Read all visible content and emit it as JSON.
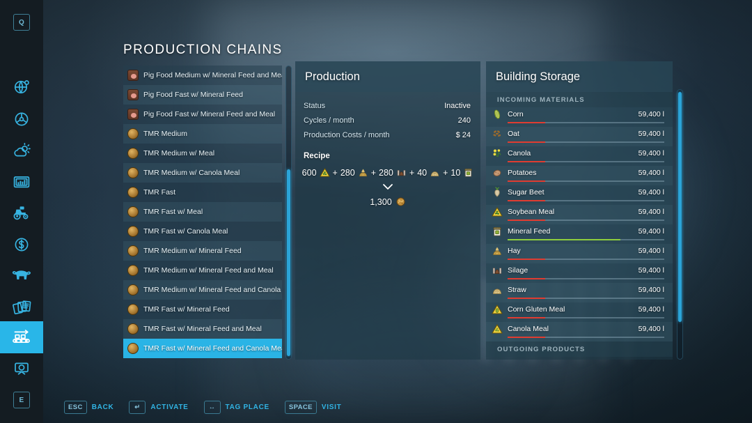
{
  "page": {
    "title": "PRODUCTION CHAINS"
  },
  "sidebar": {
    "top_key": "Q",
    "bottom_key": "E",
    "items": [
      {
        "name": "map-overview",
        "icon": "globe-icon",
        "active": false
      },
      {
        "name": "vehicles-steering",
        "icon": "steering-wheel-icon",
        "active": false
      },
      {
        "name": "weather",
        "icon": "weather-icon",
        "active": false
      },
      {
        "name": "statistics",
        "icon": "statistics-icon",
        "active": false
      },
      {
        "name": "vehicle-list",
        "icon": "tractor-icon",
        "active": false
      },
      {
        "name": "finances",
        "icon": "dollar-circle-icon",
        "active": false
      },
      {
        "name": "animals",
        "icon": "cow-icon",
        "active": false
      },
      {
        "name": "contracts",
        "icon": "documents-icon",
        "active": false
      },
      {
        "name": "production",
        "icon": "conveyor-icon",
        "active": true
      },
      {
        "name": "radio",
        "icon": "radio-icon",
        "active": false
      }
    ]
  },
  "chain_list": [
    {
      "label": "Pig Food Medium w/ Mineral Feed and Meal",
      "icon": "pig-food-icon",
      "selected": false
    },
    {
      "label": "Pig Food Fast w/ Mineral Feed",
      "icon": "pig-food-icon",
      "selected": false
    },
    {
      "label": "Pig Food Fast w/ Mineral Feed and Meal",
      "icon": "pig-food-icon",
      "selected": false
    },
    {
      "label": "TMR Medium",
      "icon": "tmr-icon",
      "selected": false
    },
    {
      "label": "TMR Medium w/ Meal",
      "icon": "tmr-icon",
      "selected": false
    },
    {
      "label": "TMR Medium w/ Canola Meal",
      "icon": "tmr-icon",
      "selected": false
    },
    {
      "label": "TMR Fast",
      "icon": "tmr-icon",
      "selected": false
    },
    {
      "label": "TMR Fast w/ Meal",
      "icon": "tmr-icon",
      "selected": false
    },
    {
      "label": "TMR Fast w/ Canola Meal",
      "icon": "tmr-icon",
      "selected": false
    },
    {
      "label": "TMR Medium w/ Mineral Feed",
      "icon": "tmr-icon",
      "selected": false
    },
    {
      "label": "TMR Medium w/ Mineral Feed and Meal",
      "icon": "tmr-icon",
      "selected": false
    },
    {
      "label": "TMR Medium w/ Mineral Feed and Canola Meal",
      "icon": "tmr-icon",
      "selected": false
    },
    {
      "label": "TMR Fast w/ Mineral Feed",
      "icon": "tmr-icon",
      "selected": false
    },
    {
      "label": "TMR Fast w/ Mineral Feed and Meal",
      "icon": "tmr-icon",
      "selected": false
    },
    {
      "label": "TMR Fast w/ Mineral Feed and Canola Meal",
      "icon": "tmr-icon",
      "selected": true
    }
  ],
  "production": {
    "header": "Production",
    "stats": [
      {
        "label": "Status",
        "value": "Inactive"
      },
      {
        "label": "Cycles / month",
        "value": "240"
      },
      {
        "label": "Production Costs / month",
        "value": "$ 24"
      }
    ],
    "recipe_title": "Recipe",
    "recipe_inputs": [
      {
        "amount": "600",
        "icon": "soybean-meal-icon"
      },
      {
        "amount": "280",
        "icon": "hay-icon"
      },
      {
        "amount": "280",
        "icon": "silage-icon"
      },
      {
        "amount": "40",
        "icon": "straw-icon"
      },
      {
        "amount": "10",
        "icon": "mineral-feed-icon"
      }
    ],
    "recipe_separator": "+",
    "recipe_arrow": "chevron-down-icon",
    "recipe_output": {
      "amount": "1,300",
      "icon": "tmr-icon"
    }
  },
  "storage": {
    "header": "Building Storage",
    "incoming_label": "INCOMING MATERIALS",
    "outgoing_label": "OUTGOING PRODUCTS",
    "incoming": [
      {
        "name": "Corn",
        "amount": "59,400 l",
        "icon": "corn-icon",
        "fill_pct": 24,
        "fill_color": "#e03c31"
      },
      {
        "name": "Oat",
        "amount": "59,400 l",
        "icon": "oat-icon",
        "fill_pct": 24,
        "fill_color": "#e03c31"
      },
      {
        "name": "Canola",
        "amount": "59,400 l",
        "icon": "canola-icon",
        "fill_pct": 24,
        "fill_color": "#e03c31"
      },
      {
        "name": "Potatoes",
        "amount": "59,400 l",
        "icon": "potato-icon",
        "fill_pct": 24,
        "fill_color": "#e03c31"
      },
      {
        "name": "Sugar Beet",
        "amount": "59,400 l",
        "icon": "sugar-beet-icon",
        "fill_pct": 24,
        "fill_color": "#e03c31"
      },
      {
        "name": "Soybean Meal",
        "amount": "59,400 l",
        "icon": "soybean-meal-icon",
        "fill_pct": 24,
        "fill_color": "#e03c31"
      },
      {
        "name": "Mineral Feed",
        "amount": "59,400 l",
        "icon": "mineral-feed-icon",
        "fill_pct": 72,
        "fill_color": "#8fce3e"
      },
      {
        "name": "Hay",
        "amount": "59,400 l",
        "icon": "hay-icon",
        "fill_pct": 24,
        "fill_color": "#e03c31"
      },
      {
        "name": "Silage",
        "amount": "59,400 l",
        "icon": "silage-icon",
        "fill_pct": 24,
        "fill_color": "#e03c31"
      },
      {
        "name": "Straw",
        "amount": "59,400 l",
        "icon": "straw-icon",
        "fill_pct": 24,
        "fill_color": "#e03c31"
      },
      {
        "name": "Corn Gluten Meal",
        "amount": "59,400 l",
        "icon": "corn-gluten-meal-icon",
        "fill_pct": 24,
        "fill_color": "#e03c31"
      },
      {
        "name": "Canola Meal",
        "amount": "59,400 l",
        "icon": "canola-meal-icon",
        "fill_pct": 24,
        "fill_color": "#e03c31"
      }
    ]
  },
  "help_bar": [
    {
      "key": "ESC",
      "label": "BACK"
    },
    {
      "key": "↵",
      "label": "ACTIVATE"
    },
    {
      "key": "↔",
      "label": "TAG PLACE"
    },
    {
      "key": "SPACE",
      "label": "VISIT"
    }
  ],
  "colors": {
    "accent": "#2ab4e6",
    "bar_low": "#e03c31",
    "bar_ok": "#8fce3e"
  }
}
